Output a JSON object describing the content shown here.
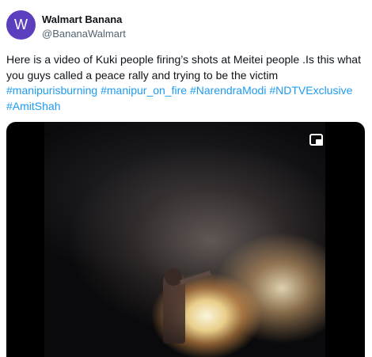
{
  "author": {
    "avatar_letter": "W",
    "avatar_color": "#5b3fbf",
    "display_name": "Walmart Banana",
    "handle": "@BananaWalmart"
  },
  "tweet": {
    "text": "Here is a video of Kuki people firing’s shots at Meitei people .Is this what you guys called a peace rally and trying to be the victim",
    "hashtags": [
      "#manipurisburning",
      "#manipur_on_fire",
      "#NarendraModi",
      "#NDTVExclusive",
      "#AmitShah"
    ],
    "hashtag_color": "#1d9bf0"
  },
  "media": {
    "type": "video",
    "controls": {
      "pip_icon": "picture-in-picture-icon"
    }
  }
}
